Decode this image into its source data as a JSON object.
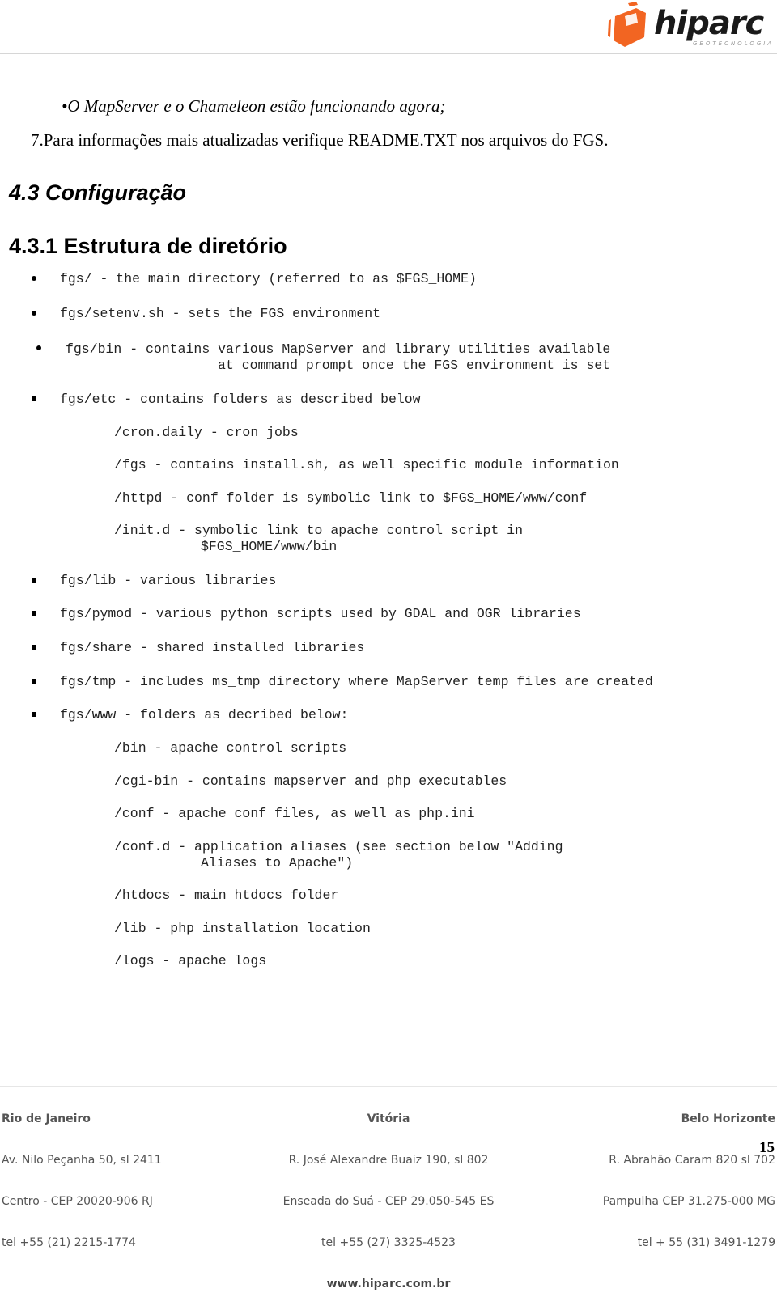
{
  "header": {
    "logo_text": "hiparc",
    "logo_subtitle": "GEOTECNOLOGIA",
    "brand_color": "#f26522"
  },
  "body": {
    "bullet_italic": "O MapServer e o Chameleon estão funcionando agora;",
    "step7": "7.Para informações mais atualizadas verifique README.TXT nos arquivos do FGS.",
    "section_heading": "4.3 Configuração",
    "subsection_heading": "4.3.1 Estrutura de diretório",
    "items": [
      {
        "bullet": "dot",
        "text": "fgs/ - the main directory (referred to as $FGS_HOME)"
      },
      {
        "bullet": "dot",
        "text": "fgs/setenv.sh - sets the FGS environment"
      },
      {
        "bullet": "dot",
        "text": "fgs/bin - contains various MapServer and library utilities available",
        "continuation": "at command prompt once the FGS environment is set"
      },
      {
        "bullet": "square",
        "text": "fgs/etc - contains folders as described below"
      }
    ],
    "etc_sub": [
      {
        "text": "/cron.daily - cron jobs"
      },
      {
        "text": "/fgs - contains install.sh, as well specific module information"
      },
      {
        "text": "/httpd - conf folder is symbolic link to $FGS_HOME/www/conf"
      },
      {
        "text": "/init.d - symbolic link to apache control script in",
        "continuation": "$FGS_HOME/www/bin"
      }
    ],
    "items2": [
      {
        "bullet": "square",
        "text": "fgs/lib - various libraries"
      },
      {
        "bullet": "square",
        "text": "fgs/pymod - various python scripts used by GDAL and OGR libraries"
      },
      {
        "bullet": "square",
        "text": "fgs/share - shared installed libraries"
      },
      {
        "bullet": "square",
        "text": "fgs/tmp - includes ms_tmp directory where MapServer temp files are created"
      },
      {
        "bullet": "square",
        "text": "fgs/www - folders as decribed below:"
      }
    ],
    "www_sub": [
      {
        "text": "/bin - apache control scripts"
      },
      {
        "text": "/cgi-bin - contains mapserver and php executables"
      },
      {
        "text": "/conf - apache conf files, as well as php.ini"
      },
      {
        "text": "/conf.d - application aliases (see section below \"Adding",
        "continuation": "Aliases to Apache\")"
      },
      {
        "text": "/htdocs - main htdocs folder"
      },
      {
        "text": "/lib - php installation location"
      },
      {
        "text": "/logs - apache logs"
      }
    ]
  },
  "footer": {
    "offices": [
      {
        "city": "Rio de Janeiro",
        "address": "Av. Nilo Peçanha 50, sl 2411",
        "district": "Centro - CEP 20020-906 RJ",
        "phone": "tel +55 (21) 2215-1774"
      },
      {
        "city": "Vitória",
        "address": "R. José Alexandre Buaiz 190, sl 802",
        "district": "Enseada do Suá - CEP 29.050-545 ES",
        "phone": "tel +55 (27) 3325-4523"
      },
      {
        "city": "Belo Horizonte",
        "address": "R. Abrahão Caram 820 sl 702",
        "district": "Pampulha CEP 31.275-000 MG",
        "phone": "tel + 55 (31) 3491-1279"
      }
    ],
    "website": "www.hiparc.com.br",
    "page_number": "15"
  }
}
